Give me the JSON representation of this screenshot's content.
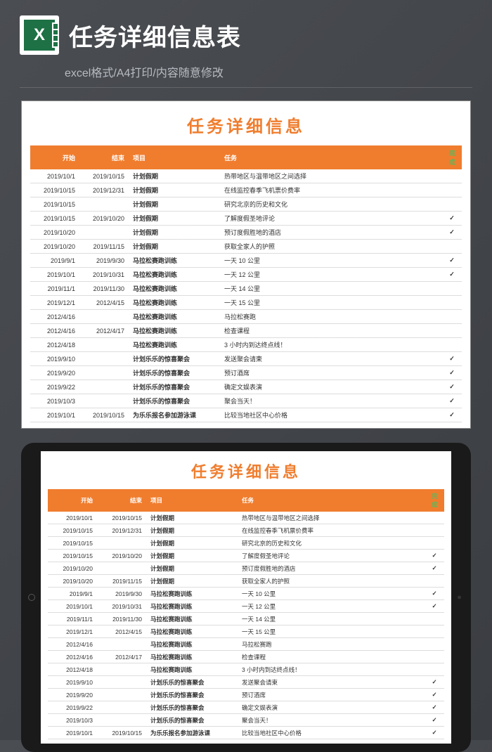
{
  "header": {
    "title": "任务详细信息表",
    "subtitle": "excel格式/A4打印/内容随意修改",
    "icon_letter": "X"
  },
  "sheet": {
    "title": "任务详细信息",
    "columns": {
      "start": "开始",
      "end": "结束",
      "project": "项目",
      "task": "任务",
      "done": "完成"
    },
    "rows": [
      {
        "start": "2019/10/1",
        "end": "2019/10/15",
        "project": "计划假期",
        "task": "热带地区与温带地区之间选择",
        "done": false
      },
      {
        "start": "2019/10/15",
        "end": "2019/12/31",
        "project": "计划假期",
        "task": "在线监控春季飞机票价费率",
        "done": false
      },
      {
        "start": "2019/10/15",
        "end": "",
        "project": "计划假期",
        "task": "研究北京的历史和文化",
        "done": false
      },
      {
        "start": "2019/10/15",
        "end": "2019/10/20",
        "project": "计划假期",
        "task": "了解度假圣地评论",
        "done": true
      },
      {
        "start": "2019/10/20",
        "end": "",
        "project": "计划假期",
        "task": "预订度假胜地的酒店",
        "done": true
      },
      {
        "start": "2019/10/20",
        "end": "2019/11/15",
        "project": "计划假期",
        "task": "获取全家人的护照",
        "done": false
      },
      {
        "start": "2019/9/1",
        "end": "2019/9/30",
        "project": "马拉松赛跑训练",
        "task": "一天 10 公里",
        "done": true
      },
      {
        "start": "2019/10/1",
        "end": "2019/10/31",
        "project": "马拉松赛跑训练",
        "task": "一天 12 公里",
        "done": true
      },
      {
        "start": "2019/11/1",
        "end": "2019/11/30",
        "project": "马拉松赛跑训练",
        "task": "一天 14 公里",
        "done": false
      },
      {
        "start": "2019/12/1",
        "end": "2012/4/15",
        "project": "马拉松赛跑训练",
        "task": "一天 15 公里",
        "done": false
      },
      {
        "start": "2012/4/16",
        "end": "",
        "project": "马拉松赛跑训练",
        "task": "马拉松赛跑",
        "done": false
      },
      {
        "start": "2012/4/16",
        "end": "2012/4/17",
        "project": "马拉松赛跑训练",
        "task": "检查课程",
        "done": false
      },
      {
        "start": "2012/4/18",
        "end": "",
        "project": "马拉松赛跑训练",
        "task": "3 小时内到达终点线！",
        "done": false
      },
      {
        "start": "2019/9/10",
        "end": "",
        "project": "计划乐乐的惊喜聚会",
        "task": "发送聚会请柬",
        "done": true
      },
      {
        "start": "2019/9/20",
        "end": "",
        "project": "计划乐乐的惊喜聚会",
        "task": "预订酒席",
        "done": true
      },
      {
        "start": "2019/9/22",
        "end": "",
        "project": "计划乐乐的惊喜聚会",
        "task": "确定文娱表演",
        "done": true
      },
      {
        "start": "2019/10/3",
        "end": "",
        "project": "计划乐乐的惊喜聚会",
        "task": "聚会当天！",
        "done": true
      },
      {
        "start": "2019/10/1",
        "end": "2019/10/15",
        "project": "为乐乐报名参加游泳课",
        "task": "比较当地社区中心价格",
        "done": true
      }
    ]
  }
}
